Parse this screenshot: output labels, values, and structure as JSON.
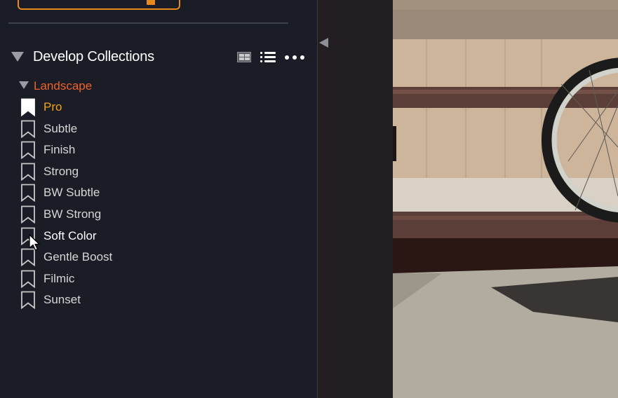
{
  "panel": {
    "section_title": "Develop Collections",
    "view_icons": [
      "grid-view-icon",
      "list-view-icon",
      "more-icon"
    ]
  },
  "collection": {
    "group_label": "Landscape",
    "presets": [
      {
        "label": "Pro",
        "state": "active"
      },
      {
        "label": "Subtle",
        "state": "normal"
      },
      {
        "label": "Finish",
        "state": "normal"
      },
      {
        "label": "Strong",
        "state": "normal"
      },
      {
        "label": "BW Subtle",
        "state": "normal"
      },
      {
        "label": "BW Strong",
        "state": "normal"
      },
      {
        "label": "Soft Color",
        "state": "hover"
      },
      {
        "label": "Gentle Boost",
        "state": "normal"
      },
      {
        "label": "Filmic",
        "state": "normal"
      },
      {
        "label": "Sunset",
        "state": "normal"
      }
    ]
  },
  "colors": {
    "panel_bg": "#1a1d26",
    "accent_orange": "#f2a21b",
    "group_label_red": "#f0622a",
    "text": "#d6d6d6"
  }
}
